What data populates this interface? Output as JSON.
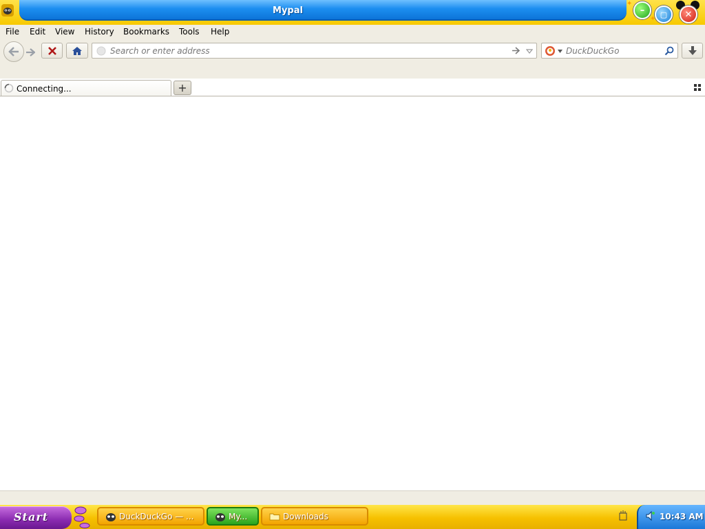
{
  "window": {
    "title": "Mypal"
  },
  "menu": {
    "items": [
      "File",
      "Edit",
      "View",
      "History",
      "Bookmarks",
      "Tools",
      "Help"
    ]
  },
  "toolbar": {
    "address_placeholder": "Search or enter address",
    "address_value": "",
    "search_placeholder": "DuckDuckGo",
    "search_value": ""
  },
  "tabs": {
    "active_label": "Connecting..."
  },
  "taskbar": {
    "start_label": "Start",
    "buttons": [
      {
        "label": "DuckDuckGo — ..."
      },
      {
        "label": "My..."
      },
      {
        "label": "Downloads"
      }
    ],
    "clock": "10:43 AM"
  },
  "colors": {
    "titlebar_blue": "#1c8ef0",
    "frame_yellow": "#f7c900",
    "chrome_bg": "#f0ede3",
    "start_purple": "#8a2bb0",
    "tray_blue": "#1b78d8"
  }
}
